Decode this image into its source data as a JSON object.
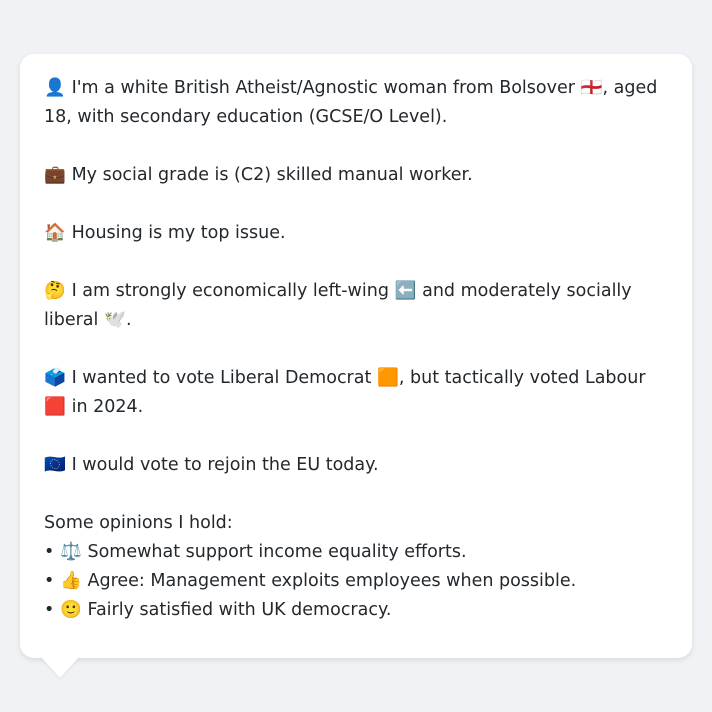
{
  "profile": {
    "identity": {
      "icon": "👤",
      "icon_name": "person-silhouette-icon",
      "text_before_flag": "I'm a white British Atheist/Agnostic woman from Bolsover",
      "flag": "🏴󠁧󠁢󠁥󠁮󠁧󠁿",
      "flag_name": "england-flag-icon",
      "text_after_flag": ", aged 18, with secondary education (GCSE/O Level)."
    },
    "grade": {
      "icon": "💼",
      "icon_name": "briefcase-icon",
      "text": "My social grade is (C2) skilled manual worker."
    },
    "issue": {
      "icon": "🏠",
      "icon_name": "house-icon",
      "text": "Housing is my top issue."
    },
    "politics": {
      "icon": "🤔",
      "icon_name": "thinking-face-icon",
      "text_1": "I am strongly economically left-wing",
      "left_icon": "⬅️",
      "left_icon_name": "left-arrow-icon",
      "text_2": "and moderately socially liberal",
      "dove_icon": "🕊️",
      "dove_icon_name": "dove-icon",
      "text_3": "."
    },
    "vote": {
      "icon": "🗳️",
      "icon_name": "ballot-box-icon",
      "text_1": "I wanted to vote Liberal Democrat",
      "libdem_icon": "🟧",
      "libdem_icon_name": "orange-square-icon",
      "text_2": ", but tactically voted Labour",
      "labour_icon": "🟥",
      "labour_icon_name": "red-square-icon",
      "text_3": "in 2024."
    },
    "eu": {
      "icon": "🇪🇺",
      "icon_name": "eu-flag-icon",
      "text": "I would vote to rejoin the EU today."
    },
    "opinions": {
      "heading": "Some opinions I hold:",
      "items": [
        {
          "bullet": "•",
          "icon": "⚖️",
          "icon_name": "scales-icon",
          "text": "Somewhat support income equality efforts."
        },
        {
          "bullet": "•",
          "icon": "👍",
          "icon_name": "thumbs-up-icon",
          "text": "Agree: Management exploits employees when possible."
        },
        {
          "bullet": "•",
          "icon": "🙂",
          "icon_name": "slightly-smiling-face-icon",
          "text": "Fairly satisfied with UK democracy."
        }
      ]
    }
  },
  "colors": {
    "background": "#f0f2f5",
    "bubble": "#ffffff",
    "text": "#23282d"
  }
}
